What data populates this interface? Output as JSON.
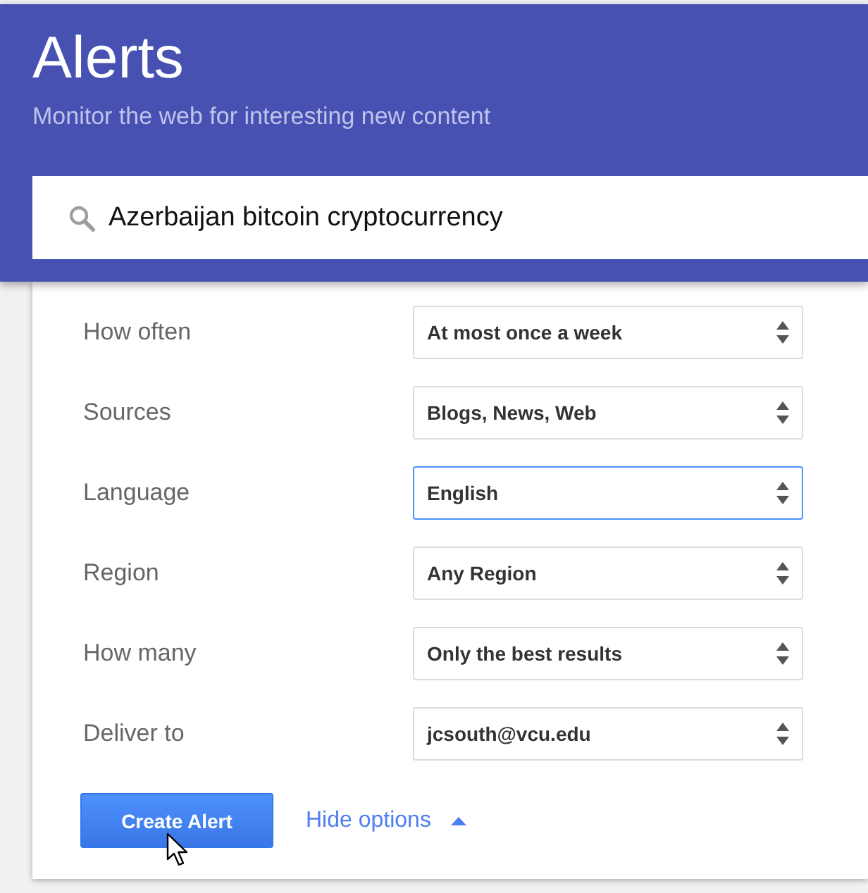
{
  "header": {
    "title": "Alerts",
    "subtitle": "Monitor the web for interesting new content"
  },
  "search": {
    "value": "Azerbaijan bitcoin cryptocurrency"
  },
  "options": [
    {
      "label": "How often",
      "value": "At most once a week",
      "focused": false
    },
    {
      "label": "Sources",
      "value": "Blogs, News, Web",
      "focused": false
    },
    {
      "label": "Language",
      "value": "English",
      "focused": true
    },
    {
      "label": "Region",
      "value": "Any Region",
      "focused": false
    },
    {
      "label": "How many",
      "value": "Only the best results",
      "focused": false
    },
    {
      "label": "Deliver to",
      "value": "jcsouth@vcu.edu",
      "focused": false
    }
  ],
  "create_button": {
    "label": "Create Alert",
    "pointer_over": true
  },
  "options_toggle": {
    "label": "Hide options",
    "expanded": true
  }
}
